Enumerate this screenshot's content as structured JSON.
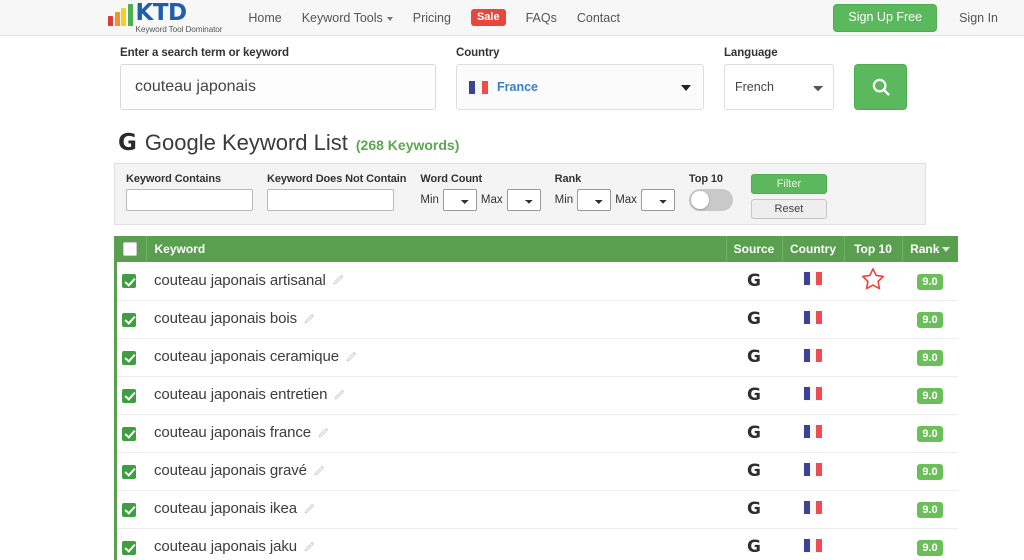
{
  "nav": {
    "logo_ktd": "KTD",
    "logo_tagline": "Keyword Tool Dominator",
    "links": [
      {
        "label": "Home",
        "icon": ""
      },
      {
        "label": "Keyword Tools",
        "icon": "chevron-down-icon"
      },
      {
        "label": "Pricing",
        "icon": ""
      },
      {
        "label": "Sale",
        "icon": ""
      },
      {
        "label": "FAQs",
        "icon": ""
      },
      {
        "label": "Contact",
        "icon": ""
      }
    ],
    "sale_label": "Sale",
    "signup_label": "Sign Up Free",
    "signin_label": "Sign In"
  },
  "search": {
    "keyword_label": "Enter a search term or keyword",
    "keyword_value": "couteau japonais",
    "keyword_placeholder": "Enter a search term or keyword",
    "country_label": "Country",
    "country_value": "France",
    "language_label": "Language",
    "language_value": "French",
    "search_icon": "search-icon"
  },
  "results": {
    "source_glyph": "G",
    "title": "Google Keyword List",
    "count_label": "(268 Keywords)"
  },
  "filters": {
    "contains_label": "Keyword Contains",
    "contains_value": "",
    "not_contains_label": "Keyword Does Not Contain",
    "not_contains_value": "",
    "word_count_label": "Word Count",
    "rank_label": "Rank",
    "min_label": "Min",
    "max_label": "Max",
    "top10_label": "Top 10",
    "top10_state": "off",
    "filter_button": "Filter",
    "reset_button": "Reset"
  },
  "table": {
    "headers": {
      "keyword": "Keyword",
      "source": "Source",
      "country": "Country",
      "top10": "Top 10",
      "rank": "Rank"
    },
    "select_all_checked": false,
    "rows": [
      {
        "checked": true,
        "keyword": "couteau japonais artisanal",
        "source": "G",
        "country": "France",
        "top10": true,
        "rank": "9.0"
      },
      {
        "checked": true,
        "keyword": "couteau japonais bois",
        "source": "G",
        "country": "France",
        "top10": false,
        "rank": "9.0"
      },
      {
        "checked": true,
        "keyword": "couteau japonais ceramique",
        "source": "G",
        "country": "France",
        "top10": false,
        "rank": "9.0"
      },
      {
        "checked": true,
        "keyword": "couteau japonais entretien",
        "source": "G",
        "country": "France",
        "top10": false,
        "rank": "9.0"
      },
      {
        "checked": true,
        "keyword": "couteau japonais france",
        "source": "G",
        "country": "France",
        "top10": false,
        "rank": "9.0"
      },
      {
        "checked": true,
        "keyword": "couteau japonais gravé",
        "source": "G",
        "country": "France",
        "top10": false,
        "rank": "9.0"
      },
      {
        "checked": true,
        "keyword": "couteau japonais ikea",
        "source": "G",
        "country": "France",
        "top10": false,
        "rank": "9.0"
      },
      {
        "checked": true,
        "keyword": "couteau japonais jaku",
        "source": "G",
        "country": "France",
        "top10": false,
        "rank": "9.0"
      }
    ]
  },
  "colors": {
    "green": "#5cb85c",
    "header_green": "#5a9e50",
    "badge_green": "#6bbf59",
    "sale_red": "#e8453c",
    "star_red": "#e8453c",
    "brand_blue": "#1f5fa9",
    "flag_blue": "#3b4395",
    "flag_red": "#ef4b52"
  }
}
